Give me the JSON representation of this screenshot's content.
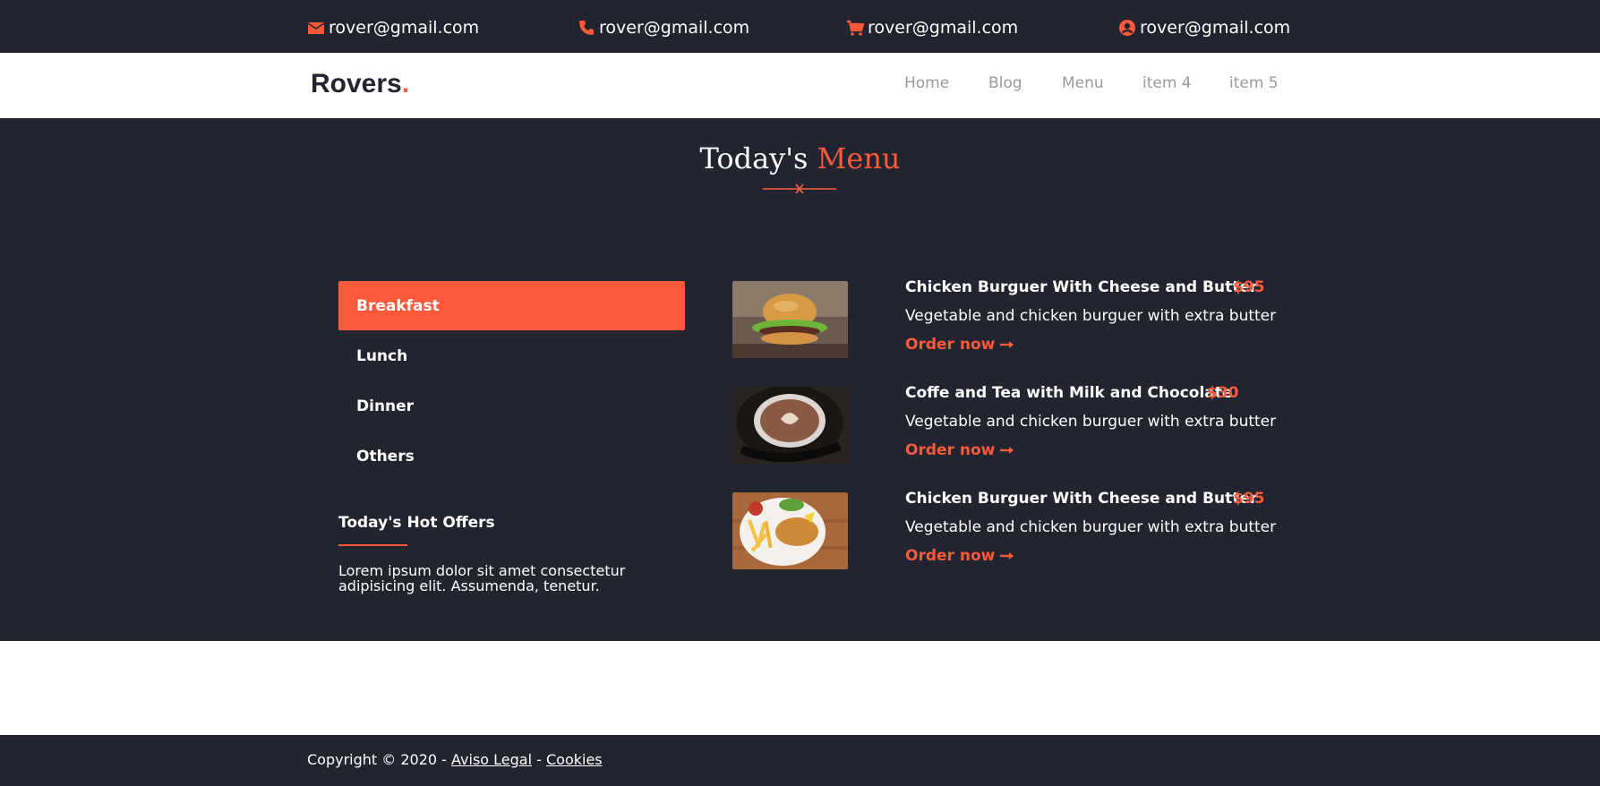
{
  "topbar": {
    "contacts": [
      {
        "icon": "envelope-icon",
        "text": "rover@gmail.com"
      },
      {
        "icon": "phone-icon",
        "text": "rover@gmail.com"
      },
      {
        "icon": "cart-icon",
        "text": "rover@gmail.com"
      },
      {
        "icon": "user-circle-icon",
        "text": "rover@gmail.com"
      }
    ]
  },
  "navbar": {
    "logo": "Rovers",
    "logo_dot": ".",
    "items": [
      "Home",
      "Blog",
      "Menu",
      "item 4",
      "item 5"
    ]
  },
  "menu": {
    "title_part1": "Today's",
    "title_part2": "Menu",
    "title_deco": "x",
    "categories": [
      "Breakfast",
      "Lunch",
      "Dinner",
      "Others"
    ],
    "active_category": "Breakfast",
    "hot_offers": {
      "title": "Today's Hot Offers",
      "text": "Lorem ipsum dolor sit amet consectetur adipisicing elit. Assumenda, tenetur."
    },
    "items": [
      {
        "name": "Chicken Burguer With Cheese and Butter",
        "price": "$95",
        "description": "Vegetable and chicken burguer with extra butter",
        "order_label": "Order now",
        "image": "burger-photo"
      },
      {
        "name": "Coffe and Tea with Milk and Chocolate",
        "price": "$30",
        "description": "Vegetable and chicken burguer with extra butter",
        "order_label": "Order now",
        "image": "coffee-photo"
      },
      {
        "name": "Chicken Burguer With Cheese and Butter",
        "price": "$95",
        "description": "Vegetable and chicken burguer with extra butter",
        "order_label": "Order now",
        "image": "fish-and-chips-photo"
      }
    ]
  },
  "footer": {
    "copyright": "Copyright © 2020 - ",
    "link1": "Aviso Legal",
    "separator": " - ",
    "link2": "Cookies"
  },
  "colors": {
    "accent": "#fc5a3b",
    "dark": "#222430",
    "nav_text": "#9a9a9a"
  }
}
